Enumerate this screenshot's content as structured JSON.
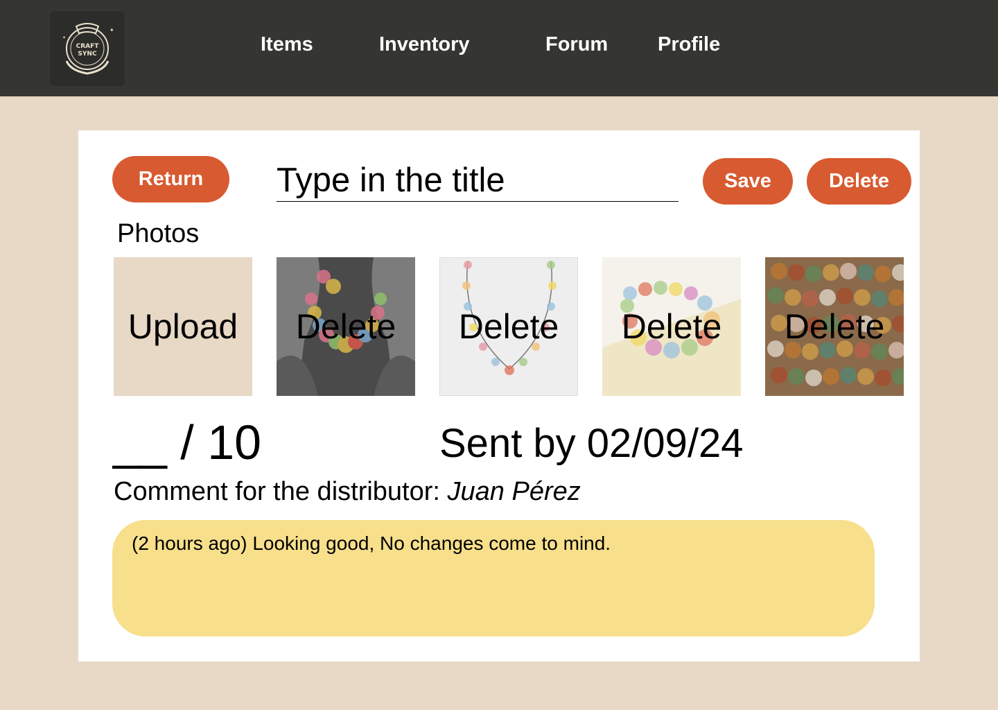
{
  "header": {
    "logo": {
      "text_line1": "CRAFT",
      "text_line2": "SYNC"
    },
    "nav": [
      {
        "label": "Items"
      },
      {
        "label": "Inventory"
      },
      {
        "label": "Forum"
      },
      {
        "label": "Profile"
      }
    ]
  },
  "editor": {
    "return_label": "Return",
    "title_placeholder": "Type in the title",
    "save_label": "Save",
    "delete_label": "Delete",
    "photos_label": "Photos",
    "upload_label": "Upload",
    "photos": [
      {
        "action_label": "Delete",
        "subject": "necklace on bust"
      },
      {
        "action_label": "Delete",
        "subject": "necklace on white"
      },
      {
        "action_label": "Delete",
        "subject": "bead bracelet"
      },
      {
        "action_label": "Delete",
        "subject": "bead strands"
      }
    ],
    "score_text": "__ / 10",
    "sent_by_text": "Sent by 02/09/24",
    "comment_label": "Comment for the distributor:",
    "comment_author": "Juan Pérez",
    "comment_text": "(2 hours ago) Looking good, No changes come to mind."
  },
  "colors": {
    "header_bg": "#353632",
    "page_bg": "#e8d8c6",
    "accent": "#d85a30",
    "comment_bg": "#f7df8c"
  }
}
